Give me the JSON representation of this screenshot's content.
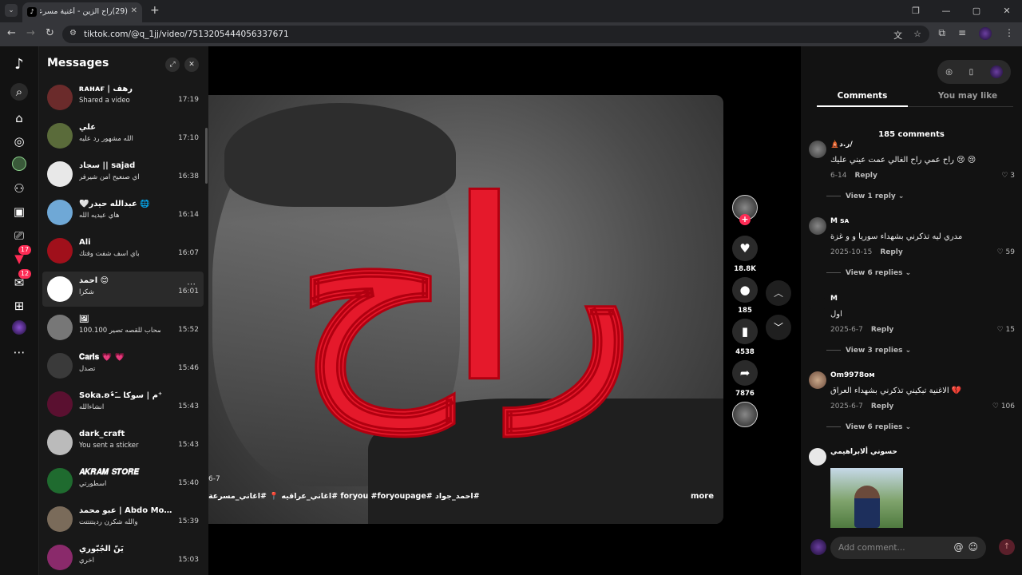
{
  "browser": {
    "tab_title": "(29)راح الزين - أغنية مسرعة للفنا...",
    "tab_favicon": "tiktok-icon",
    "url": "tiktok.com/@q_1jj/video/7513205444056337671"
  },
  "rail": {
    "notifications_badge": "17",
    "messages_badge": "12"
  },
  "messages": {
    "title": "Messages",
    "conversations": [
      {
        "name": "ʀᴀʜᴀғ | رهف",
        "last": "Shared a video",
        "time": "17:19",
        "color": "#6b2b2b"
      },
      {
        "name": "علي",
        "last": "الله مشهور رد عليه",
        "time": "17:10",
        "color": "#5a6b3a"
      },
      {
        "name": "سجاد || sajad",
        "last": "اي صنعيح امن شيرفر",
        "time": "16:38",
        "color": "#e8e8e8"
      },
      {
        "name": "🤍عبدالله حيدر 🌐",
        "last": "هاي عيديه الله",
        "time": "16:14",
        "color": "#6fa8d6"
      },
      {
        "name": "Ali",
        "last": "باي اسف شفت وقتك",
        "time": "16:07",
        "color": "#a0101b"
      },
      {
        "name": "احمد 😊",
        "last": "شكرا",
        "time": "16:01",
        "color": "#ffffff"
      },
      {
        "name": "🖼",
        "last": "100.100 هتصر صحاب للقصه تصير",
        "time": "15:52",
        "color": "#777777"
      },
      {
        "name": "𝐂𝐚𝐫𝐢𝐬 💗 💗",
        "last": "تصدل",
        "time": "15:46",
        "color": "#3a3a3a"
      },
      {
        "name": "Soka.ʚ•ُمِ | سوكا ــَ⁺",
        "last": "انشاءالله",
        "time": "15:43",
        "color": "#5a1030"
      },
      {
        "name": "dark_craft",
        "last": "You sent a sticker",
        "time": "15:43",
        "color": "#bbbbbb"
      },
      {
        "name": "𝑨𝑲𝑹𝑨𝑴 𝑺𝑻𝑶𝑹𝑬",
        "last": "اسطورتي",
        "time": "15:40",
        "color": "#1f6b2f"
      },
      {
        "name": "عبو محمد | Abdo Moham...",
        "last": "والله شكرن رديتتتتت",
        "time": "15:39",
        "color": "#7a6b5a"
      },
      {
        "name": "يَنّ الجُبُّوري",
        "last": "اخري",
        "time": "15:03",
        "color": "#8a2a6b"
      }
    ]
  },
  "video": {
    "overlay_word": "راح",
    "date": "6-7",
    "caption": "#احمد_جواد #foryou #foryoupage #اغاني_عراقيه 📍 #اغاني_مسرعة",
    "more_label": "more",
    "likes": "18.8K",
    "comments": "185",
    "saves": "4538",
    "shares": "7876"
  },
  "comments_panel": {
    "tab_comments": "Comments",
    "tab_you_may_like": "You may like",
    "count_label": "185 comments",
    "reply_label": "Reply",
    "items": [
      {
        "user": "🛕ر.د/",
        "text": "راح عمي راح الغالي عمت عيني عليك 😢 😢",
        "date": "6-14",
        "likes": "3",
        "replies": "View 1 reply"
      },
      {
        "user": "M ꜱᴀ",
        "text": "مدري ليه تذكرني بشهداء سوريا و و غزة",
        "date": "2025-10-15",
        "likes": "59",
        "replies": "View 6 replies"
      },
      {
        "user": "M",
        "text": "اول",
        "date": "2025-6-7",
        "likes": "15",
        "replies": "View 3 replies"
      },
      {
        "user": "Om9978ᴏᴍ",
        "text": "الاغنية تبكيني تذكرني بشهداء العراق 💔",
        "date": "2025-6-7",
        "likes": "106",
        "replies": "View 6 replies"
      },
      {
        "user": "حسوني ألابراهيمي",
        "text": "",
        "date": "",
        "likes": "",
        "replies": ""
      }
    ],
    "add_comment_placeholder": "Add comment..."
  }
}
